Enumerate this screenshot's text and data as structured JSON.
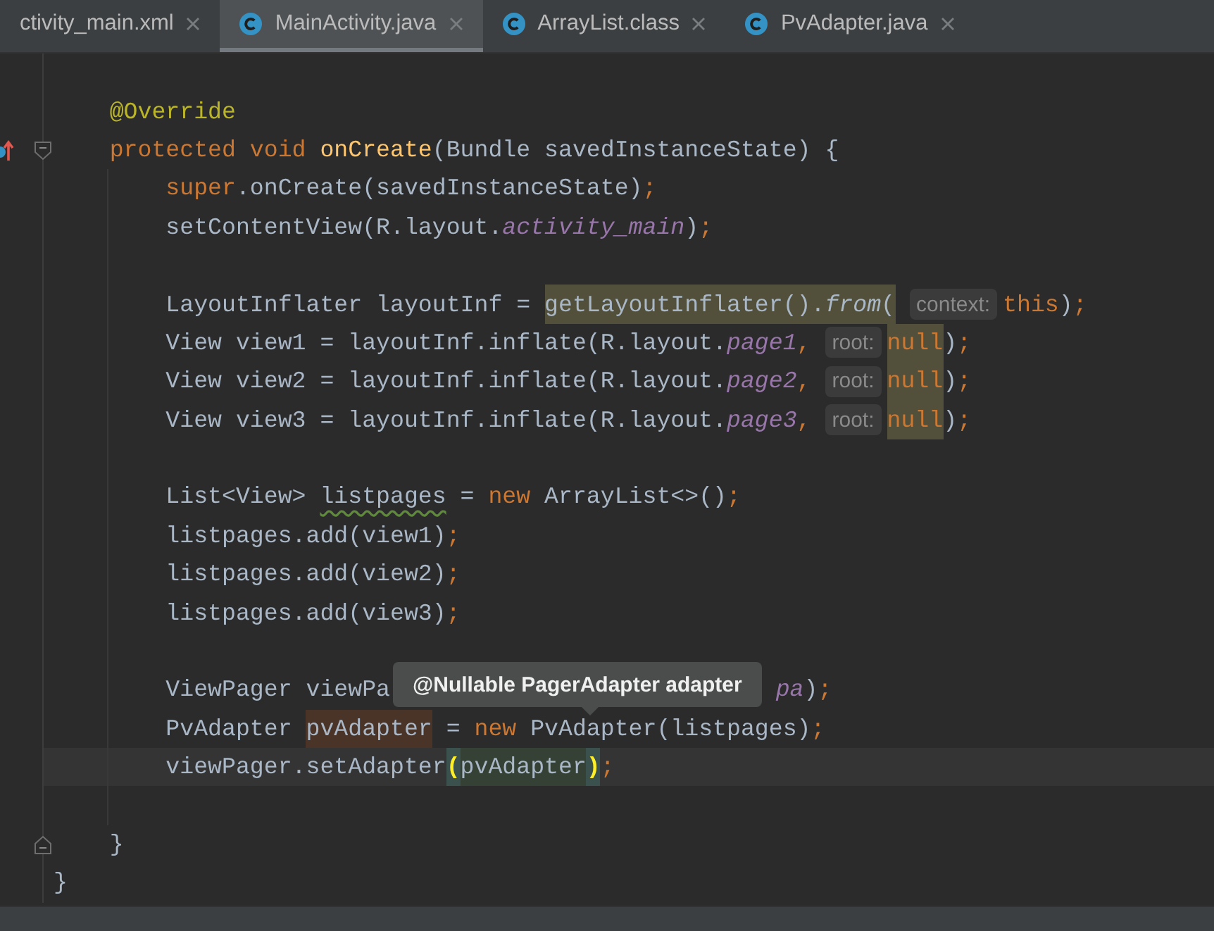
{
  "tabs": [
    {
      "label": "ctivity_main.xml",
      "selected": false
    },
    {
      "label": "MainActivity.java",
      "selected": true
    },
    {
      "label": "ArrayList.class",
      "selected": false
    },
    {
      "label": "PvAdapter.java",
      "selected": false
    }
  ],
  "editor": {
    "lines": [
      {
        "kind": "code"
      },
      {
        "kind": "code",
        "tokens": [
          {
            "text": "    @Override",
            "kind": "annotation"
          }
        ]
      },
      {
        "kind": "method-start",
        "tokens": [
          {
            "text": "    protected void ",
            "kind": "keyword"
          },
          {
            "text": "onCreate",
            "kind": "method"
          },
          {
            "text": "(Bundle savedInstanceState) {",
            "kind": "plain"
          }
        ]
      },
      {
        "kind": "code",
        "tokens": [
          {
            "text": "        super",
            "kind": "keyword"
          },
          {
            "text": ".onCreate(savedInstanceState)",
            "kind": "plain"
          },
          {
            "text": ";",
            "kind": "punct"
          }
        ]
      },
      {
        "kind": "code",
        "tokens": [
          {
            "text": "        setContentView(R.layout.",
            "kind": "plain"
          },
          {
            "text": "activity_main",
            "kind": "field"
          },
          {
            "text": ")",
            "kind": "plain"
          },
          {
            "text": ";",
            "kind": "punct"
          }
        ]
      },
      {
        "kind": "code"
      },
      {
        "kind": "code",
        "tokens": [
          {
            "text": "        LayoutInflater layoutInf = ",
            "kind": "plain"
          },
          {
            "text": "getLayoutInflater().",
            "kind": "usage"
          },
          {
            "text": "from",
            "kind": "usage-static"
          },
          {
            "text": "(",
            "kind": "usage"
          },
          {
            "text": "context:",
            "kind": "hint"
          },
          {
            "text": "this",
            "kind": "keyword"
          },
          {
            "text": ")",
            "kind": "plain"
          },
          {
            "text": ";",
            "kind": "punct"
          }
        ]
      },
      {
        "kind": "code",
        "tokens": [
          {
            "text": "        View view1 = layoutInf.inflate(R.layout.",
            "kind": "plain"
          },
          {
            "text": "page1",
            "kind": "field"
          },
          {
            "text": ",",
            "kind": "punct"
          },
          {
            "text": "root:",
            "kind": "hint"
          },
          {
            "text": "null",
            "kind": "usage-keyword"
          },
          {
            "text": ")",
            "kind": "plain"
          },
          {
            "text": ";",
            "kind": "punct"
          }
        ]
      },
      {
        "kind": "code",
        "tokens": [
          {
            "text": "        View view2 = layoutInf.inflate(R.layout.",
            "kind": "plain"
          },
          {
            "text": "page2",
            "kind": "field"
          },
          {
            "text": ",",
            "kind": "punct"
          },
          {
            "text": "root:",
            "kind": "hint"
          },
          {
            "text": "null",
            "kind": "usage-keyword"
          },
          {
            "text": ")",
            "kind": "plain"
          },
          {
            "text": ";",
            "kind": "punct"
          }
        ]
      },
      {
        "kind": "code",
        "tokens": [
          {
            "text": "        View view3 = layoutInf.inflate(R.layout.",
            "kind": "plain"
          },
          {
            "text": "page3",
            "kind": "field"
          },
          {
            "text": ",",
            "kind": "punct"
          },
          {
            "text": "root:",
            "kind": "hint"
          },
          {
            "text": "null",
            "kind": "usage-keyword"
          },
          {
            "text": ")",
            "kind": "plain"
          },
          {
            "text": ";",
            "kind": "punct"
          }
        ]
      },
      {
        "kind": "code"
      },
      {
        "kind": "code",
        "tokens": [
          {
            "text": "        List<View> ",
            "kind": "plain"
          },
          {
            "text": "listpages",
            "kind": "typo"
          },
          {
            "text": " = ",
            "kind": "plain"
          },
          {
            "text": "new ",
            "kind": "keyword"
          },
          {
            "text": "ArrayList<>()",
            "kind": "plain"
          },
          {
            "text": ";",
            "kind": "punct"
          }
        ]
      },
      {
        "kind": "code",
        "tokens": [
          {
            "text": "        listpages.add(view1)",
            "kind": "plain"
          },
          {
            "text": ";",
            "kind": "punct"
          }
        ]
      },
      {
        "kind": "code",
        "tokens": [
          {
            "text": "        listpages.add(view2)",
            "kind": "plain"
          },
          {
            "text": ";",
            "kind": "punct"
          }
        ]
      },
      {
        "kind": "code",
        "tokens": [
          {
            "text": "        listpages.add(view3)",
            "kind": "plain"
          },
          {
            "text": ";",
            "kind": "punct"
          }
        ]
      },
      {
        "kind": "code"
      },
      {
        "kind": "code",
        "tokens": [
          {
            "text": "        ViewPager viewPa",
            "kind": "plain"
          },
          {
            "kind": "gap"
          },
          {
            "text": "pa",
            "kind": "field"
          },
          {
            "text": ")",
            "kind": "plain"
          },
          {
            "text": ";",
            "kind": "punct"
          }
        ]
      },
      {
        "kind": "code",
        "tokens": [
          {
            "text": "        PvAdapter ",
            "kind": "plain"
          },
          {
            "text": "pvAdapter",
            "kind": "write"
          },
          {
            "text": " = ",
            "kind": "plain"
          },
          {
            "text": "new ",
            "kind": "keyword"
          },
          {
            "text": "PvAdapter(listpages)",
            "kind": "plain"
          },
          {
            "text": ";",
            "kind": "punct"
          }
        ]
      },
      {
        "kind": "current-line",
        "tokens": [
          {
            "text": "        viewPager.setAdapter",
            "kind": "plain"
          },
          {
            "text": "(",
            "kind": "brace"
          },
          {
            "text": "pvAdapter",
            "kind": "arg"
          },
          {
            "text": ")",
            "kind": "brace"
          },
          {
            "text": ";",
            "kind": "punct"
          }
        ]
      },
      {
        "kind": "code"
      },
      {
        "kind": "method-end",
        "tokens": [
          {
            "text": "    }",
            "kind": "plain"
          }
        ]
      },
      {
        "kind": "code",
        "tokens": [
          {
            "text": "}",
            "kind": "plain"
          }
        ]
      }
    ],
    "tooltip": {
      "text": "@Nullable PagerAdapter adapter"
    }
  }
}
